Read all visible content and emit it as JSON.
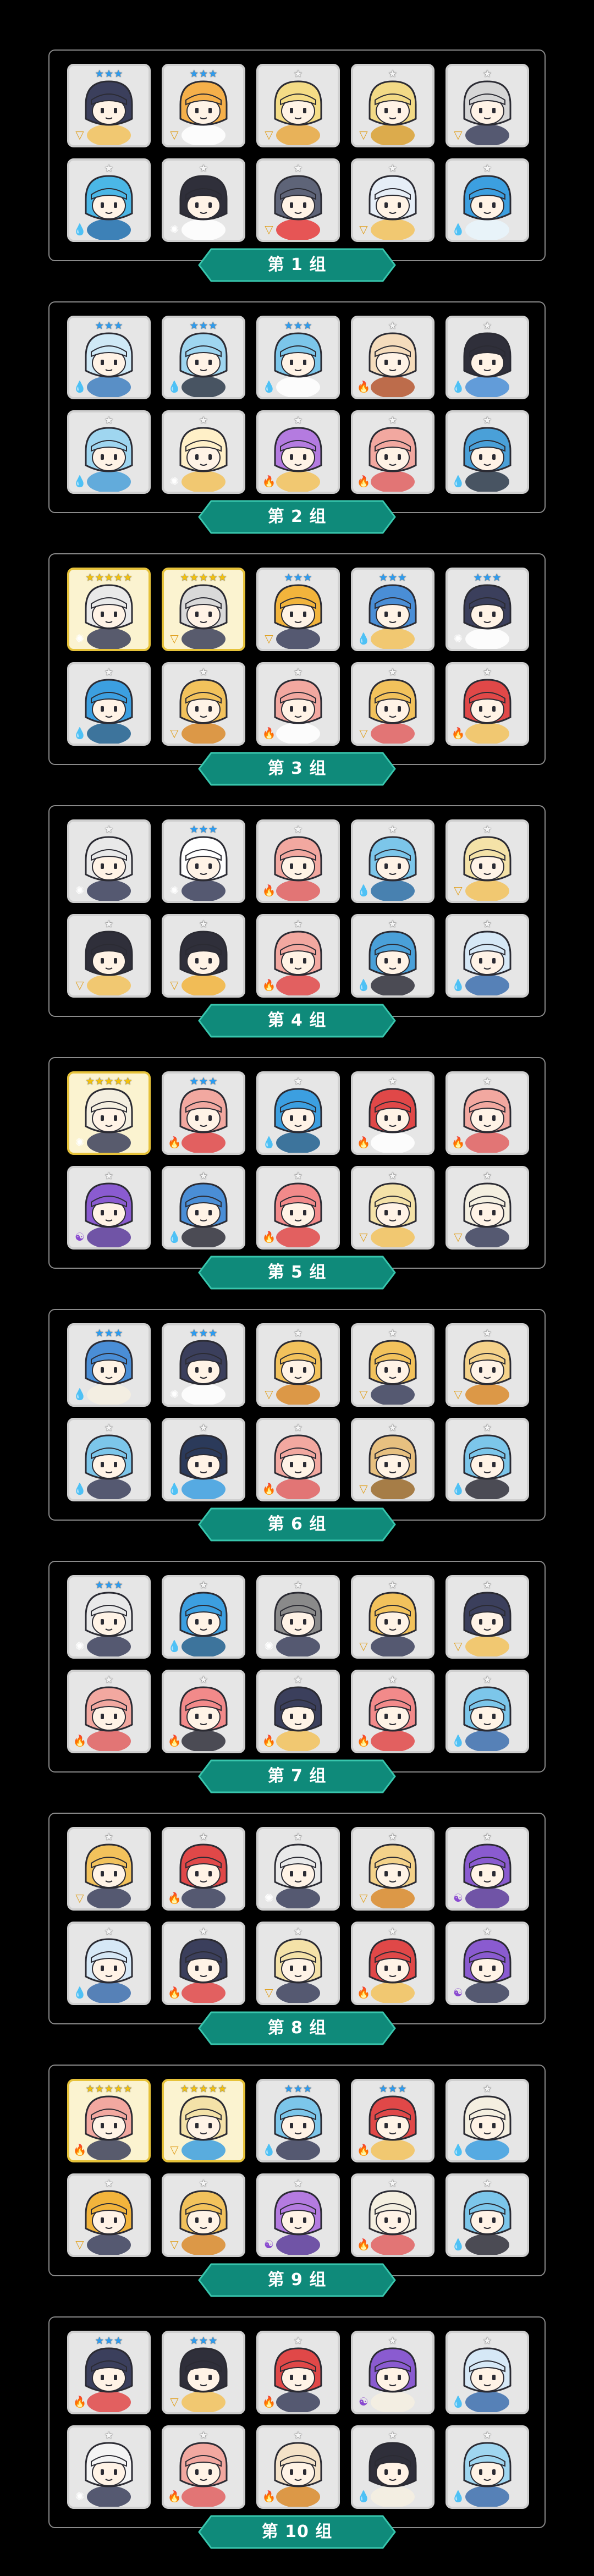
{
  "groups": [
    {
      "label": "第 1 组",
      "cards": [
        {
          "stars": "blue",
          "color": "#3b3f5c",
          "accent": "#f2c25c",
          "element": "earth"
        },
        {
          "stars": "blue",
          "color": "#f5b04a",
          "accent": "#ffffff",
          "element": "earth"
        },
        {
          "stars": "grey",
          "color": "#f4dc86",
          "accent": "#e7a840",
          "element": "earth"
        },
        {
          "stars": "grey",
          "color": "#f2da86",
          "accent": "#d9a030",
          "element": "earth"
        },
        {
          "stars": "grey",
          "color": "#d6d6d6",
          "accent": "#3b3f5c",
          "element": "earth"
        },
        {
          "stars": "none",
          "color": "#4bb7e6",
          "accent": "#1f6fae",
          "element": "water"
        },
        {
          "stars": "none",
          "color": "#2f2f3a",
          "accent": "#ffffff",
          "element": "wind"
        },
        {
          "stars": "none",
          "color": "#5e6478",
          "accent": "#e53b3b",
          "element": "earth"
        },
        {
          "stars": "none",
          "color": "#e6eef7",
          "accent": "#f2c25c",
          "element": "earth"
        },
        {
          "stars": "none",
          "color": "#3c9fe0",
          "accent": "#e8f4fb",
          "element": "water"
        }
      ]
    },
    {
      "label": "第 2 组",
      "cards": [
        {
          "stars": "blue",
          "color": "#cfe9f6",
          "accent": "#3f7fbf",
          "element": "water"
        },
        {
          "stars": "blue",
          "color": "#9fd6f0",
          "accent": "#2b3a4a",
          "element": "water"
        },
        {
          "stars": "blue",
          "color": "#7cc6ea",
          "accent": "#ffffff",
          "element": "water"
        },
        {
          "stars": "grey",
          "color": "#f5dcbc",
          "accent": "#b5562f",
          "element": "fire"
        },
        {
          "stars": "grey",
          "color": "#2f2f3a",
          "accent": "#4a8ed6",
          "element": "water"
        },
        {
          "stars": "none",
          "color": "#9fd6f0",
          "accent": "#4aa0d8",
          "element": "water"
        },
        {
          "stars": "none",
          "color": "#fff0c8",
          "accent": "#f2c25c",
          "element": "wind"
        },
        {
          "stars": "none",
          "color": "#b47be0",
          "accent": "#f2c25c",
          "element": "fire"
        },
        {
          "stars": "none",
          "color": "#f2a8a0",
          "accent": "#e06060",
          "element": "fire"
        },
        {
          "stars": "none",
          "color": "#4aa0d8",
          "accent": "#2b3a4a",
          "element": "water"
        }
      ]
    },
    {
      "label": "第 3 组",
      "cards": [
        {
          "stars": "gold",
          "color": "#e9e9e9",
          "accent": "#3b3f5c",
          "element": "wind",
          "gold": true
        },
        {
          "stars": "gold",
          "color": "#d9d9d9",
          "accent": "#3b3f5c",
          "element": "earth",
          "gold": true
        },
        {
          "stars": "blue",
          "color": "#f2b43c",
          "accent": "#3b3f5c",
          "element": "earth"
        },
        {
          "stars": "blue",
          "color": "#4a8ed6",
          "accent": "#f2c25c",
          "element": "water"
        },
        {
          "stars": "blue",
          "color": "#3b3f5c",
          "accent": "#ffffff",
          "element": "wind"
        },
        {
          "stars": "none",
          "color": "#3c9fe0",
          "accent": "#1f5f8e",
          "element": "water"
        },
        {
          "stars": "none",
          "color": "#f2c25c",
          "accent": "#d98a2a",
          "element": "earth"
        },
        {
          "stars": "none",
          "color": "#f2a8a0",
          "accent": "#ffffff",
          "element": "fire"
        },
        {
          "stars": "none",
          "color": "#f2c25c",
          "accent": "#e06060",
          "element": "earth"
        },
        {
          "stars": "none",
          "color": "#e04848",
          "accent": "#f2c25c",
          "element": "fire"
        }
      ]
    },
    {
      "label": "第 4 组",
      "cards": [
        {
          "stars": "grey",
          "color": "#e9e9e9",
          "accent": "#3b3f5c",
          "element": "wind"
        },
        {
          "stars": "blue",
          "color": "#ffffff",
          "accent": "#3b3f5c",
          "element": "wind"
        },
        {
          "stars": "grey",
          "color": "#f2a8a0",
          "accent": "#e06060",
          "element": "fire"
        },
        {
          "stars": "grey",
          "color": "#7cc6ea",
          "accent": "#2b6fa6",
          "element": "water"
        },
        {
          "stars": "grey",
          "color": "#f4e2a8",
          "accent": "#f2c25c",
          "element": "earth"
        },
        {
          "stars": "none",
          "color": "#2f2f3a",
          "accent": "#f2c25c",
          "element": "earth"
        },
        {
          "stars": "none",
          "color": "#2f2f3a",
          "accent": "#f2b43c",
          "element": "earth"
        },
        {
          "stars": "none",
          "color": "#f2a8a0",
          "accent": "#e04848",
          "element": "fire"
        },
        {
          "stars": "none",
          "color": "#4aa0d8",
          "accent": "#2f2f3a",
          "element": "water"
        },
        {
          "stars": "none",
          "color": "#d6e8f6",
          "accent": "#3c6fae",
          "element": "water"
        }
      ]
    },
    {
      "label": "第 5 组",
      "cards": [
        {
          "stars": "gold",
          "color": "#f4efe0",
          "accent": "#3b3f5c",
          "element": "wind",
          "gold": true
        },
        {
          "stars": "blue",
          "color": "#f2a8a0",
          "accent": "#e04848",
          "element": "fire"
        },
        {
          "stars": "grey",
          "color": "#3c9fe0",
          "accent": "#1f5f8e",
          "element": "water"
        },
        {
          "stars": "grey",
          "color": "#e04848",
          "accent": "#ffffff",
          "element": "fire"
        },
        {
          "stars": "grey",
          "color": "#f2a8a0",
          "accent": "#e06060",
          "element": "fire"
        },
        {
          "stars": "none",
          "color": "#8a5bd0",
          "accent": "#5a3a9a",
          "element": "dark"
        },
        {
          "stars": "none",
          "color": "#4a8ed6",
          "accent": "#2f2f3a",
          "element": "water"
        },
        {
          "stars": "none",
          "color": "#f28a8a",
          "accent": "#e04848",
          "element": "fire"
        },
        {
          "stars": "none",
          "color": "#f4e2a8",
          "accent": "#f2c25c",
          "element": "earth"
        },
        {
          "stars": "none",
          "color": "#f4efe0",
          "accent": "#3b3f5c",
          "element": "earth"
        }
      ]
    },
    {
      "label": "第 6 组",
      "cards": [
        {
          "stars": "blue",
          "color": "#4a8ed6",
          "accent": "#f4efe0",
          "element": "water"
        },
        {
          "stars": "blue",
          "color": "#3b3f5c",
          "accent": "#ffffff",
          "element": "wind"
        },
        {
          "stars": "grey",
          "color": "#f2c25c",
          "accent": "#d98a2a",
          "element": "earth"
        },
        {
          "stars": "grey",
          "color": "#f2c25c",
          "accent": "#3b3f5c",
          "element": "earth"
        },
        {
          "stars": "grey",
          "color": "#f4d28a",
          "accent": "#d98a2a",
          "element": "earth"
        },
        {
          "stars": "none",
          "color": "#7cc6ea",
          "accent": "#3b3f5c",
          "element": "water"
        },
        {
          "stars": "none",
          "color": "#2b3a5a",
          "accent": "#3c9fe0",
          "element": "water"
        },
        {
          "stars": "none",
          "color": "#f2a8a0",
          "accent": "#e06060",
          "element": "fire"
        },
        {
          "stars": "none",
          "color": "#e7c080",
          "accent": "#9a6a2a",
          "element": "earth"
        },
        {
          "stars": "none",
          "color": "#7cc6ea",
          "accent": "#2f2f3a",
          "element": "water"
        }
      ]
    },
    {
      "label": "第 7 组",
      "cards": [
        {
          "stars": "blue",
          "color": "#e9e9e9",
          "accent": "#3b3f5c",
          "element": "wind"
        },
        {
          "stars": "grey",
          "color": "#3c9fe0",
          "accent": "#1f5f8e",
          "element": "water"
        },
        {
          "stars": "grey",
          "color": "#8a8a8a",
          "accent": "#3b3f5c",
          "element": "wind"
        },
        {
          "stars": "grey",
          "color": "#f2c25c",
          "accent": "#3b3f5c",
          "element": "earth"
        },
        {
          "stars": "grey",
          "color": "#3b3f5c",
          "accent": "#f2c25c",
          "element": "earth"
        },
        {
          "stars": "none",
          "color": "#f2a8a0",
          "accent": "#e06060",
          "element": "fire"
        },
        {
          "stars": "none",
          "color": "#f28a8a",
          "accent": "#2f2f3a",
          "element": "fire"
        },
        {
          "stars": "none",
          "color": "#3b3f5c",
          "accent": "#f2c25c",
          "element": "fire"
        },
        {
          "stars": "none",
          "color": "#f28a8a",
          "accent": "#e04848",
          "element": "fire"
        },
        {
          "stars": "none",
          "color": "#7cc6ea",
          "accent": "#3c6fae",
          "element": "water"
        }
      ]
    },
    {
      "label": "第 8 组",
      "cards": [
        {
          "stars": "grey",
          "color": "#f2c25c",
          "accent": "#3b3f5c",
          "element": "earth"
        },
        {
          "stars": "grey",
          "color": "#e04848",
          "accent": "#3b3f5c",
          "element": "fire"
        },
        {
          "stars": "grey",
          "color": "#e9e9e9",
          "accent": "#3b3f5c",
          "element": "wind"
        },
        {
          "stars": "grey",
          "color": "#f4d28a",
          "accent": "#d98a2a",
          "element": "earth"
        },
        {
          "stars": "grey",
          "color": "#8a5bd0",
          "accent": "#5a3a9a",
          "element": "dark"
        },
        {
          "stars": "none",
          "color": "#d6e8f6",
          "accent": "#3c6fae",
          "element": "water"
        },
        {
          "stars": "none",
          "color": "#3b3f5c",
          "accent": "#e04848",
          "element": "fire"
        },
        {
          "stars": "none",
          "color": "#f4e2a8",
          "accent": "#3b3f5c",
          "element": "earth"
        },
        {
          "stars": "none",
          "color": "#e04848",
          "accent": "#f2c25c",
          "element": "fire"
        },
        {
          "stars": "none",
          "color": "#8a5bd0",
          "accent": "#3b3f5c",
          "element": "dark"
        }
      ]
    },
    {
      "label": "第 9 组",
      "cards": [
        {
          "stars": "gold",
          "color": "#f2a8a0",
          "accent": "#3b3f5c",
          "element": "fire",
          "gold": true
        },
        {
          "stars": "gold",
          "color": "#f4e2a8",
          "accent": "#3c9fe0",
          "element": "earth",
          "gold": true
        },
        {
          "stars": "blue",
          "color": "#7cc6ea",
          "accent": "#3b3f5c",
          "element": "water"
        },
        {
          "stars": "blue",
          "color": "#e04848",
          "accent": "#f2c25c",
          "element": "fire"
        },
        {
          "stars": "grey",
          "color": "#f4efe0",
          "accent": "#3c9fe0",
          "element": "water"
        },
        {
          "stars": "none",
          "color": "#f2b43c",
          "accent": "#3b3f5c",
          "element": "earth"
        },
        {
          "stars": "none",
          "color": "#f2c25c",
          "accent": "#d98a2a",
          "element": "earth"
        },
        {
          "stars": "none",
          "color": "#b47be0",
          "accent": "#5a3a9a",
          "element": "dark"
        },
        {
          "stars": "none",
          "color": "#f4efe0",
          "accent": "#e06060",
          "element": "fire"
        },
        {
          "stars": "none",
          "color": "#7cc6ea",
          "accent": "#2f2f3a",
          "element": "water"
        }
      ]
    },
    {
      "label": "第 10 组",
      "cards": [
        {
          "stars": "blue",
          "color": "#3b3f5c",
          "accent": "#e04848",
          "element": "fire"
        },
        {
          "stars": "blue",
          "color": "#2f2f3a",
          "accent": "#f2c25c",
          "element": "earth"
        },
        {
          "stars": "grey",
          "color": "#e04848",
          "accent": "#3b3f5c",
          "element": "fire"
        },
        {
          "stars": "grey",
          "color": "#8a5bd0",
          "accent": "#f4efe0",
          "element": "dark"
        },
        {
          "stars": "grey",
          "color": "#d6e8f6",
          "accent": "#3c6fae",
          "element": "water"
        },
        {
          "stars": "none",
          "color": "#f4f4f4",
          "accent": "#3b3f5c",
          "element": "wind"
        },
        {
          "stars": "none",
          "color": "#f2a8a0",
          "accent": "#e06060",
          "element": "fire"
        },
        {
          "stars": "none",
          "color": "#f4e2c8",
          "accent": "#d98a2a",
          "element": "fire"
        },
        {
          "stars": "none",
          "color": "#2f2f3a",
          "accent": "#f4efe0",
          "element": "water"
        },
        {
          "stars": "none",
          "color": "#9fd6f0",
          "accent": "#3c6fae",
          "element": "water"
        }
      ]
    }
  ],
  "colors": {
    "band_fill": "#0f8a7a",
    "band_outline": "#38c6ad",
    "panel_border": "#8a8a8a",
    "background": "#000000"
  },
  "element_icons": {
    "water": "💧",
    "fire": "🔥",
    "earth": "▽",
    "wind": "✺",
    "dark": "☯"
  }
}
